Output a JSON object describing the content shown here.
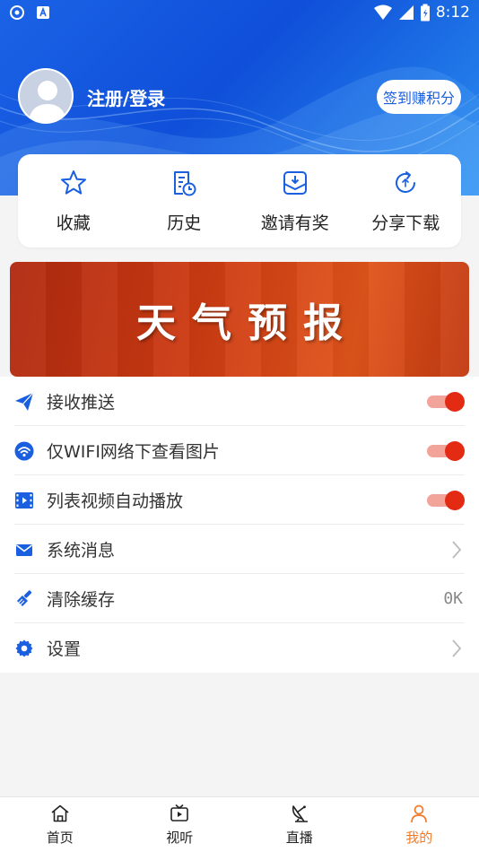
{
  "status_bar": {
    "time": "8:12"
  },
  "profile": {
    "login_label": "注册/登录",
    "sign_in_button": "签到赚积分"
  },
  "quick_actions": [
    {
      "label": "收藏",
      "icon": "star-icon"
    },
    {
      "label": "历史",
      "icon": "history-icon"
    },
    {
      "label": "邀请有奖",
      "icon": "invite-icon"
    },
    {
      "label": "分享下载",
      "icon": "share-icon"
    }
  ],
  "banner": {
    "title": "天气预报"
  },
  "settings": {
    "items": [
      {
        "label": "接收推送",
        "icon": "paper-plane-icon",
        "control": "toggle",
        "on": true
      },
      {
        "label": "仅WIFI网络下查看图片",
        "icon": "wifi-icon",
        "control": "toggle",
        "on": true
      },
      {
        "label": "列表视频自动播放",
        "icon": "video-icon",
        "control": "toggle",
        "on": true
      },
      {
        "label": "系统消息",
        "icon": "mail-icon",
        "control": "chevron"
      },
      {
        "label": "清除缓存",
        "icon": "broom-icon",
        "control": "value",
        "value": "0K"
      },
      {
        "label": "设置",
        "icon": "gear-icon",
        "control": "chevron"
      }
    ]
  },
  "tabbar": {
    "tabs": [
      {
        "label": "首页",
        "icon": "home-icon",
        "active": false
      },
      {
        "label": "视听",
        "icon": "tv-icon",
        "active": false
      },
      {
        "label": "直播",
        "icon": "satellite-dish-icon",
        "active": false
      },
      {
        "label": "我的",
        "icon": "user-icon",
        "active": true
      }
    ]
  },
  "colors": {
    "header_blue": "#1b63e6",
    "accent_blue": "#1a5fe0",
    "toggle_red": "#e32b14",
    "tab_active_orange": "#f07c2a"
  }
}
